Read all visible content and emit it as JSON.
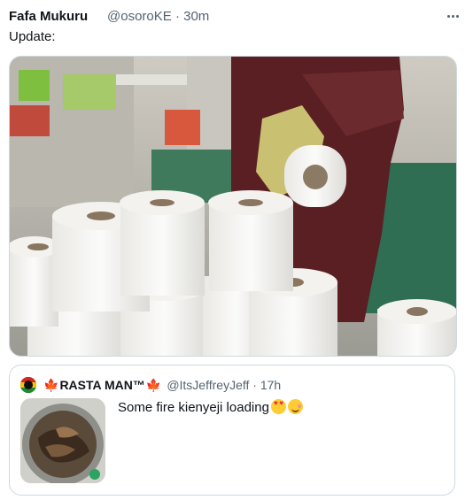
{
  "tweet": {
    "author_name": "Fafa Mukuru",
    "author_handle": "@osoroKE",
    "separator": "·",
    "time": "30m",
    "text": "Update:",
    "more_icon": "more-horizontal-icon",
    "photo_icon": "toilet-paper-photo"
  },
  "quote": {
    "name_prefix": "🍁",
    "display_name": "RASTA MAN™",
    "name_suffix": "🍁",
    "handle": "@ItsJeffreyJeff",
    "separator": "·",
    "time": "17h",
    "text": "Some fire kienyeji loading",
    "emojis": [
      "heart-eyes-emoji",
      "smiling-face-emoji"
    ],
    "avatar_colors": [
      "#d7261e",
      "#f6c700",
      "#1f8a2e"
    ]
  },
  "colors": {
    "text_primary": "#0f1419",
    "text_secondary": "#536471",
    "border": "#cfd9de"
  }
}
